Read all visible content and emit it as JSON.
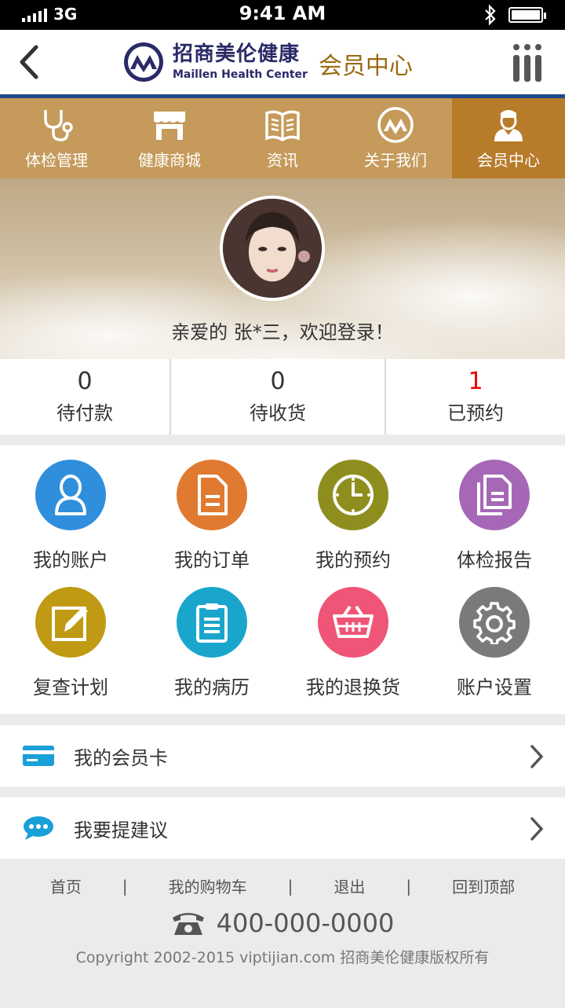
{
  "status": {
    "network": "3G",
    "time": "9:41 AM"
  },
  "header": {
    "brand_cn": "招商美伦健康",
    "brand_en": "Maillen Health Center",
    "title": "会员中心"
  },
  "nav": [
    {
      "label": "体检管理"
    },
    {
      "label": "健康商城"
    },
    {
      "label": "资讯"
    },
    {
      "label": "关于我们"
    },
    {
      "label": "会员中心"
    }
  ],
  "profile": {
    "welcome": "亲爱的 张*三，欢迎登录！"
  },
  "stats": [
    {
      "count": "0",
      "label": "待付款"
    },
    {
      "count": "0",
      "label": "待收货"
    },
    {
      "count": "1",
      "label": "已预约"
    }
  ],
  "grid": [
    {
      "label": "我的账户",
      "icon": "user-icon",
      "color": "#2f8fdc"
    },
    {
      "label": "我的订单",
      "icon": "document-icon",
      "color": "#e07a30"
    },
    {
      "label": "我的预约",
      "icon": "clock-icon",
      "color": "#8e8e1e"
    },
    {
      "label": "体检报告",
      "icon": "report-icon",
      "color": "#a668b6"
    },
    {
      "label": "复查计划",
      "icon": "edit-icon",
      "color": "#c09a12"
    },
    {
      "label": "我的病历",
      "icon": "clipboard-icon",
      "color": "#1aa6cc"
    },
    {
      "label": "我的退换货",
      "icon": "basket-icon",
      "color": "#ef5576"
    },
    {
      "label": "账户设置",
      "icon": "gear-icon",
      "color": "#7a7a7a"
    }
  ],
  "rows": [
    {
      "label": "我的会员卡"
    },
    {
      "label": "我要提建议"
    }
  ],
  "footer": {
    "links": [
      "首页",
      "|",
      "我的购物车",
      "|",
      "退出",
      "|",
      "回到顶部"
    ],
    "phone": "400-000-0000",
    "copyright": "Copyright 2002-2015 viptijian.com  招商美伦健康版权所有"
  }
}
